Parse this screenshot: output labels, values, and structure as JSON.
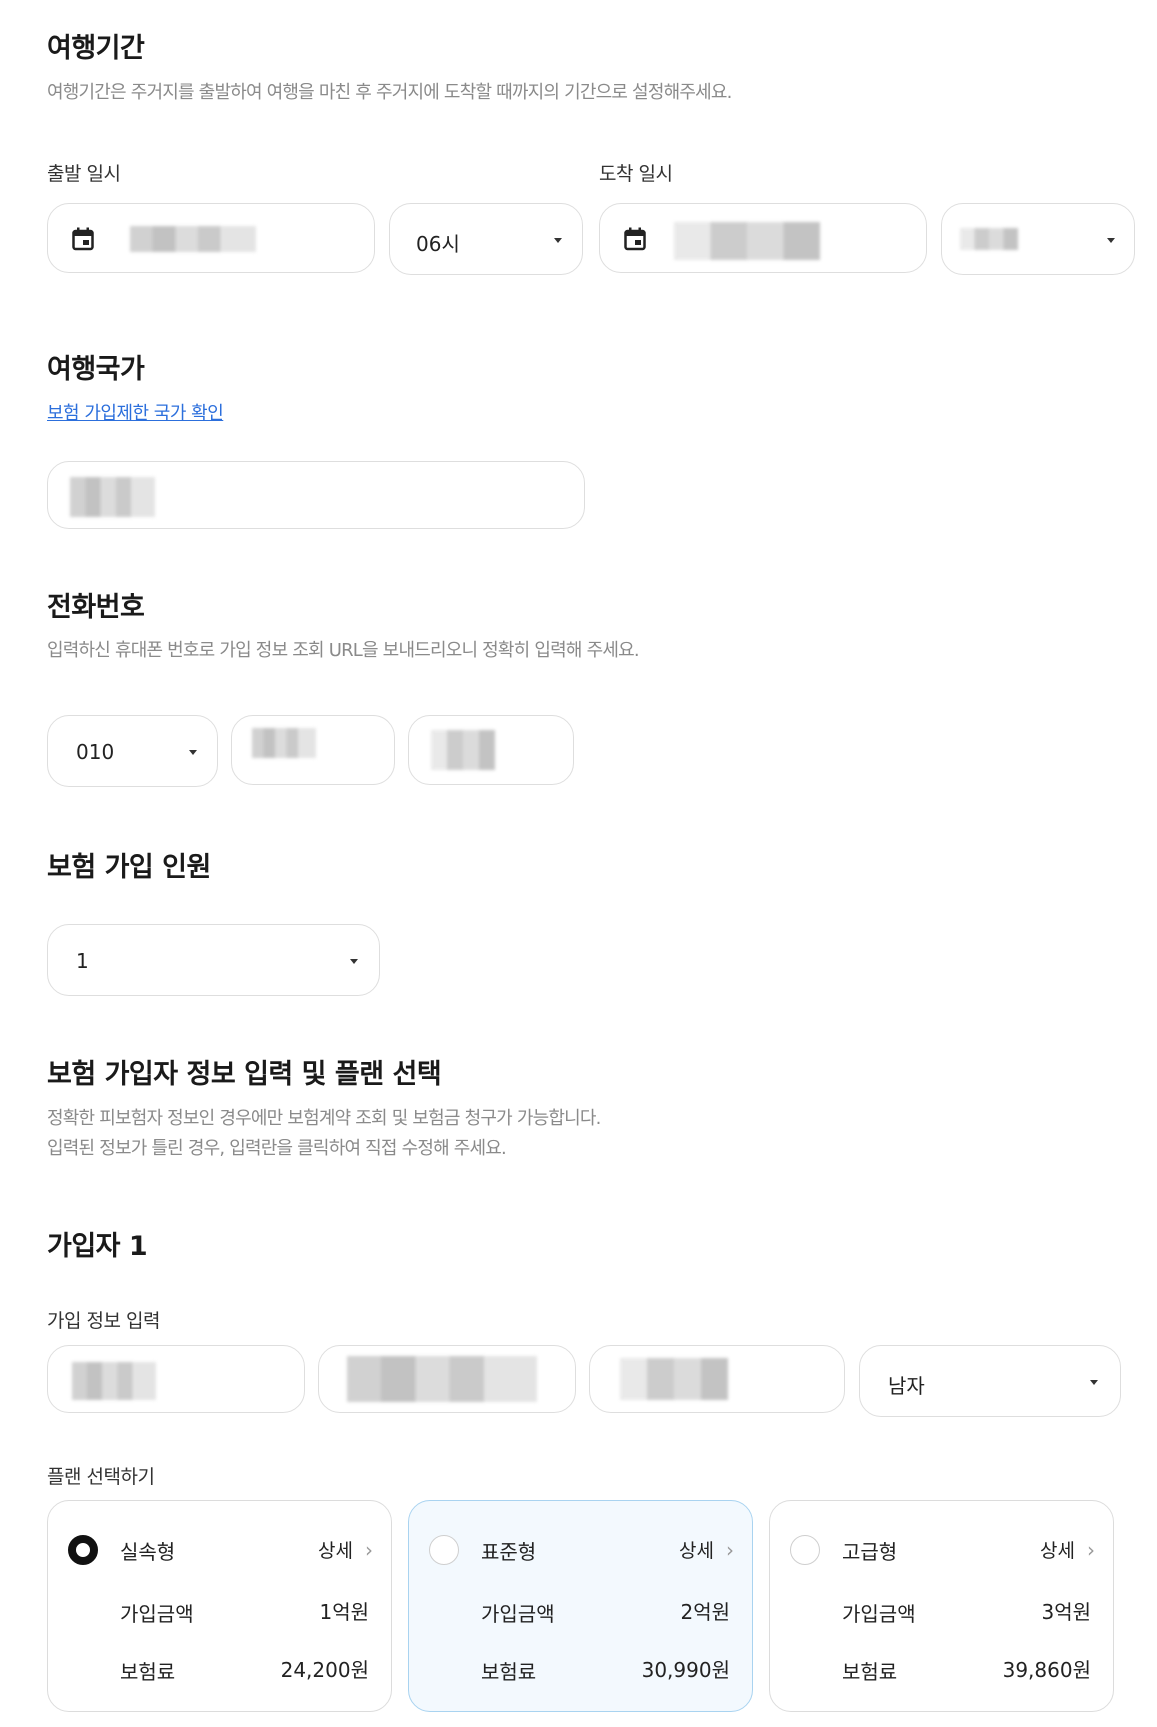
{
  "travel_period": {
    "title": "여행기간",
    "description": "여행기간은 주거지를 출발하여 여행을 마친 후 주거지에 도착할 때까지의 기간으로 설정해주세요.",
    "departure_label": "출발 일시",
    "arrival_label": "도착 일시",
    "departure_hour": "06시"
  },
  "travel_country": {
    "title": "여행국가",
    "restricted_link": "보험 가입제한 국가 확인"
  },
  "phone": {
    "title": "전화번호",
    "description": "입력하신 휴대폰 번호로 가입 정보 조회 URL을 보내드리오니 정확히 입력해 주세요.",
    "prefix": "010"
  },
  "insured_count": {
    "title": "보험 가입 인원",
    "value": "1"
  },
  "insured_info": {
    "title": "보험 가입자 정보 입력 및 플랜 선택",
    "description_line1": "정확한 피보험자 정보인 경우에만 보험계약 조회 및 보험금 청구가 가능합니다.",
    "description_line2": "입력된 정보가 틀린 경우, 입력란을 클릭하여 직접 수정해 주세요."
  },
  "member1": {
    "title": "가입자 1",
    "info_label": "가입 정보 입력",
    "gender": "남자",
    "plan_label": "플랜 선택하기"
  },
  "plans": [
    {
      "name": "실속형",
      "detail": "상세",
      "amount_label": "가입금액",
      "amount": "1억원",
      "premium_label": "보험료",
      "premium": "24,200원",
      "selected": true
    },
    {
      "name": "표준형",
      "detail": "상세",
      "amount_label": "가입금액",
      "amount": "2억원",
      "premium_label": "보험료",
      "premium": "30,990원",
      "selected": false
    },
    {
      "name": "고급형",
      "detail": "상세",
      "amount_label": "가입금액",
      "amount": "3억원",
      "premium_label": "보험료",
      "premium": "39,860원",
      "selected": false
    }
  ],
  "icons": {
    "calendar": "calendar-icon",
    "dropdown": "caret-down-icon",
    "chevron": "chevron-right-icon",
    "radio": "radio-icon"
  },
  "colors": {
    "link": "#2c6fdc",
    "selected_plan_bg": "#f3f9fe",
    "selected_plan_border": "#a9d3f0"
  }
}
